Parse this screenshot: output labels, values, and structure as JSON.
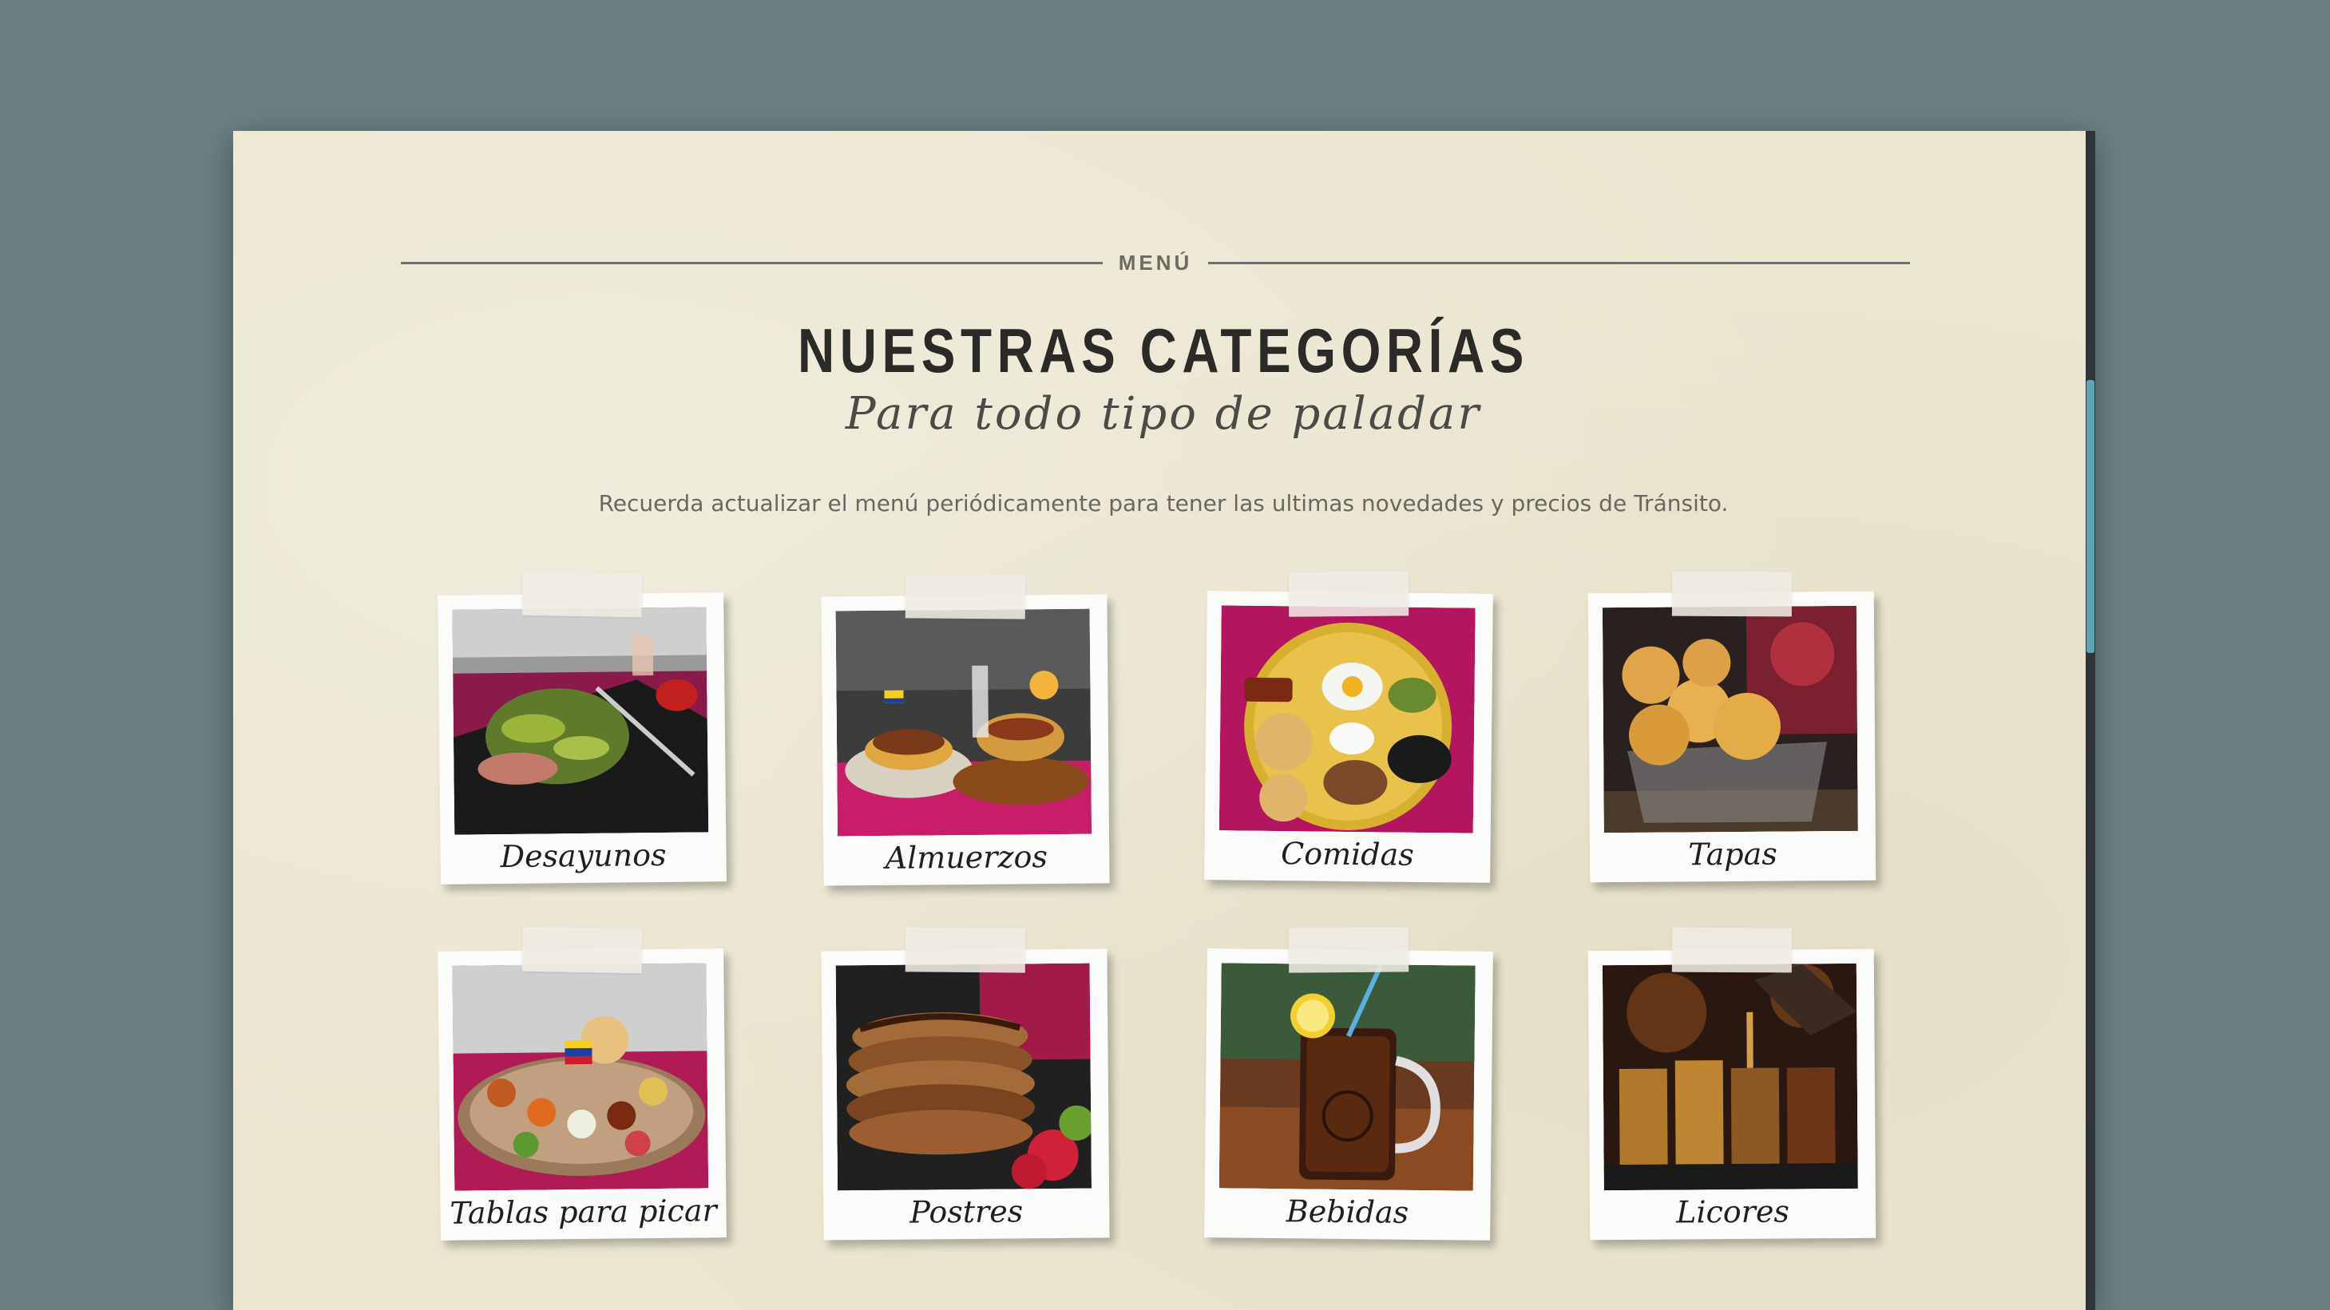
{
  "section": {
    "label": "MENÚ"
  },
  "title": "NUESTRAS CATEGORÍAS",
  "subtitle": "Para todo tipo de paladar",
  "notice": "Recuerda actualizar el menú periódicamente para tener las ultimas novedades y precios de Tránsito.",
  "categories": [
    {
      "label": "Desayunos",
      "icon": "breakfast-photo"
    },
    {
      "label": "Almuerzos",
      "icon": "lunch-photo"
    },
    {
      "label": "Comidas",
      "icon": "meals-photo"
    },
    {
      "label": "Tapas",
      "icon": "tapas-photo"
    },
    {
      "label": "Tablas para picar",
      "icon": "platters-photo"
    },
    {
      "label": "Postres",
      "icon": "desserts-photo"
    },
    {
      "label": "Bebidas",
      "icon": "drinks-photo"
    },
    {
      "label": "Licores",
      "icon": "liquors-photo"
    }
  ],
  "colors": {
    "page_bg": "#6b7f85",
    "paper": "#ebe6d0",
    "accent_teal": "#5ea5b3",
    "magenta": "#b3155e"
  }
}
